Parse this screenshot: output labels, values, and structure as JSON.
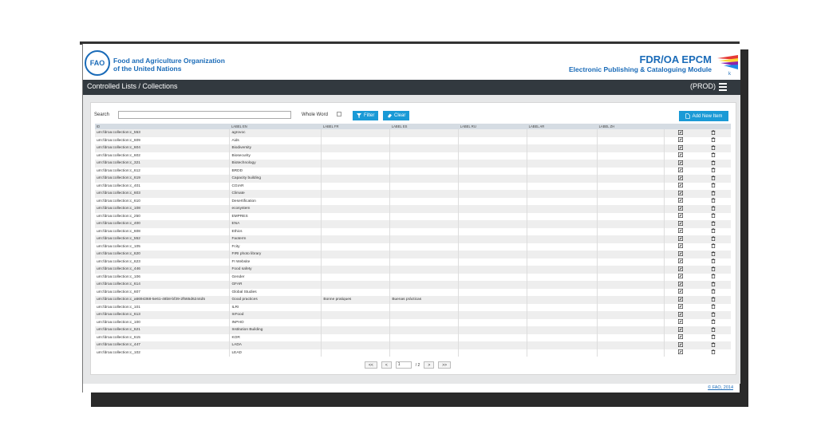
{
  "header": {
    "logo_text": "FAO",
    "org_line1": "Food and Agriculture Organization",
    "org_line2": "of the United Nations",
    "app_title": "FDR/OA EPCM",
    "app_subtitle": "Electronic Publishing & Cataloguing Module"
  },
  "titlebar": {
    "breadcrumb": "Controlled Lists / Collections",
    "environment": "(PROD)"
  },
  "toolbar": {
    "search_label": "Search",
    "search_value": "",
    "whole_word_label": "Whole Word",
    "filter_label": "Filter",
    "clear_label": "Clear",
    "add_label": "Add New Item"
  },
  "table": {
    "columns": [
      "ID",
      "LABEL EN",
      "LABEL FR",
      "LABEL ES",
      "LABEL RU",
      "LABEL AR",
      "LABEL ZH"
    ],
    "rows": [
      [
        "urn:fdroa:collection:c_553",
        "agrovoc",
        "",
        "",
        "",
        "",
        ""
      ],
      [
        "urn:fdroa:collection:c_609",
        "Aids",
        "",
        "",
        "",
        "",
        ""
      ],
      [
        "urn:fdroa:collection:c_604",
        "Biodiversity",
        "",
        "",
        "",
        "",
        ""
      ],
      [
        "urn:fdroa:collection:c_602",
        "Biosecurity",
        "",
        "",
        "",
        "",
        ""
      ],
      [
        "urn:fdroa:collection:c_321",
        "Biotechnology",
        "",
        "",
        "",
        "",
        ""
      ],
      [
        "urn:fdroa:collection:c_612",
        "BRDD",
        "",
        "",
        "",
        "",
        ""
      ],
      [
        "urn:fdroa:collection:c_619",
        "Capacity building",
        "",
        "",
        "",
        "",
        ""
      ],
      [
        "urn:fdroa:collection:c_401",
        "CGIAR",
        "",
        "",
        "",
        "",
        ""
      ],
      [
        "urn:fdroa:collection:c_603",
        "Climate",
        "",
        "",
        "",
        "",
        ""
      ],
      [
        "urn:fdroa:collection:c_610",
        "Desertification",
        "",
        "",
        "",
        "",
        ""
      ],
      [
        "urn:fdroa:collection:c_108",
        "ecosystem",
        "",
        "",
        "",
        "",
        ""
      ],
      [
        "urn:fdroa:collection:c_250",
        "EMPRES",
        "",
        "",
        "",
        "",
        ""
      ],
      [
        "urn:fdroa:collection:c_400",
        "ENA",
        "",
        "",
        "",
        "",
        ""
      ],
      [
        "urn:fdroa:collection:c_608",
        "Ethics",
        "",
        "",
        "",
        "",
        ""
      ],
      [
        "urn:fdroa:collection:c_552",
        "Faoterm",
        "",
        "",
        "",
        "",
        ""
      ],
      [
        "urn:fdroa:collection:c_105",
        "Fcity",
        "",
        "",
        "",
        "",
        ""
      ],
      [
        "urn:fdroa:collection:c_620",
        "FIRI photo library",
        "",
        "",
        "",
        "",
        ""
      ],
      [
        "urn:fdroa:collection:c_623",
        "FI Website",
        "",
        "",
        "",
        "",
        ""
      ],
      [
        "urn:fdroa:collection:c_446",
        "Food safety",
        "",
        "",
        "",
        "",
        ""
      ],
      [
        "urn:fdroa:collection:c_106",
        "Gender",
        "",
        "",
        "",
        "",
        ""
      ],
      [
        "urn:fdroa:collection:c_614",
        "GFAR",
        "",
        "",
        "",
        "",
        ""
      ],
      [
        "urn:fdroa:collection:c_607",
        "Global Studies",
        "",
        "",
        "",
        "",
        ""
      ],
      [
        "urn:fdroa:collection:c_a6694368-5e61-48b8-bf39-2f565d6244d5",
        "Good practices",
        "Bonne pratiques",
        "Buenas prácticas",
        "",
        "",
        ""
      ],
      [
        "urn:fdroa:collection:c_101",
        "ILRI",
        "",
        "",
        "",
        "",
        ""
      ],
      [
        "urn:fdroa:collection:c_613",
        "InFood",
        "",
        "",
        "",
        "",
        ""
      ],
      [
        "urn:fdroa:collection:c_100",
        "INPHO",
        "",
        "",
        "",
        "",
        ""
      ],
      [
        "urn:fdroa:collection:c_621",
        "Institution Building",
        "",
        "",
        "",
        "",
        ""
      ],
      [
        "urn:fdroa:collection:c_615",
        "KOR",
        "",
        "",
        "",
        "",
        ""
      ],
      [
        "urn:fdroa:collection:c_447",
        "LADA",
        "",
        "",
        "",
        "",
        ""
      ],
      [
        "urn:fdroa:collection:c_102",
        "LEAD",
        "",
        "",
        "",
        "",
        ""
      ]
    ]
  },
  "pager": {
    "first": "<<",
    "prev": "<",
    "current_page": "1",
    "total_text": "/ 2",
    "next": ">",
    "last": ">>"
  },
  "footer": {
    "copyright": "© FAO, 2014"
  },
  "colors": {
    "brand_blue": "#1a6bb8",
    "button_blue": "#1a9ad6",
    "titlebar": "#32393f"
  }
}
